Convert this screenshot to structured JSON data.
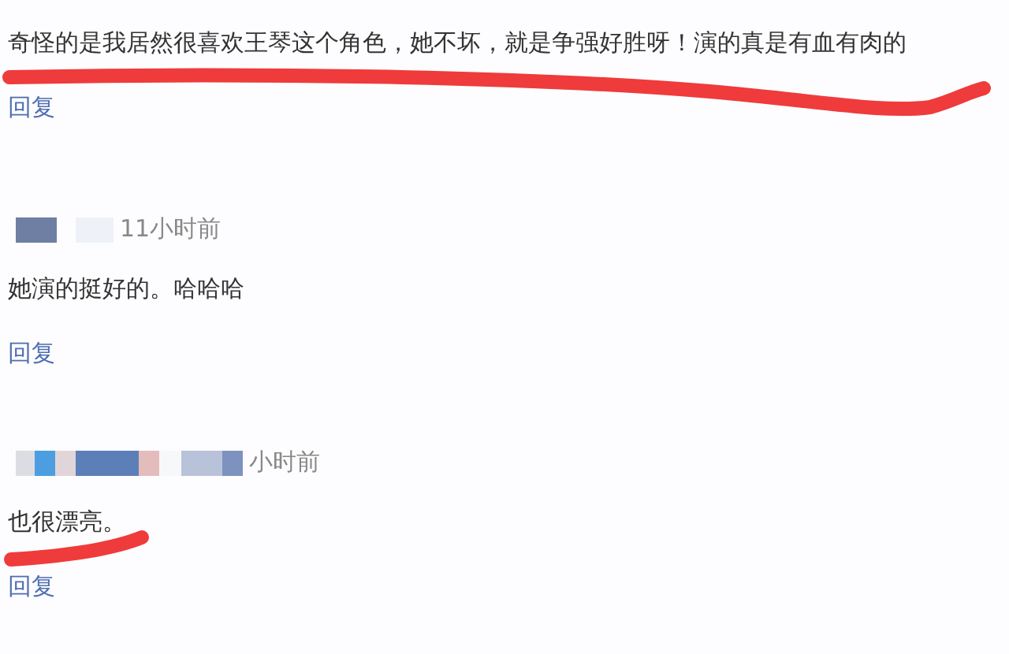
{
  "comments": [
    {
      "text": "奇怪的是我居然很喜欢王琴这个角色，她不坏，就是争强好胜呀！演的真是有血有肉的",
      "reply": "回复"
    },
    {
      "time": "11小时前",
      "text": "她演的挺好的。哈哈哈",
      "reply": "回复"
    },
    {
      "time": "小时前",
      "text": "也很漂亮。",
      "reply": "回复"
    }
  ]
}
